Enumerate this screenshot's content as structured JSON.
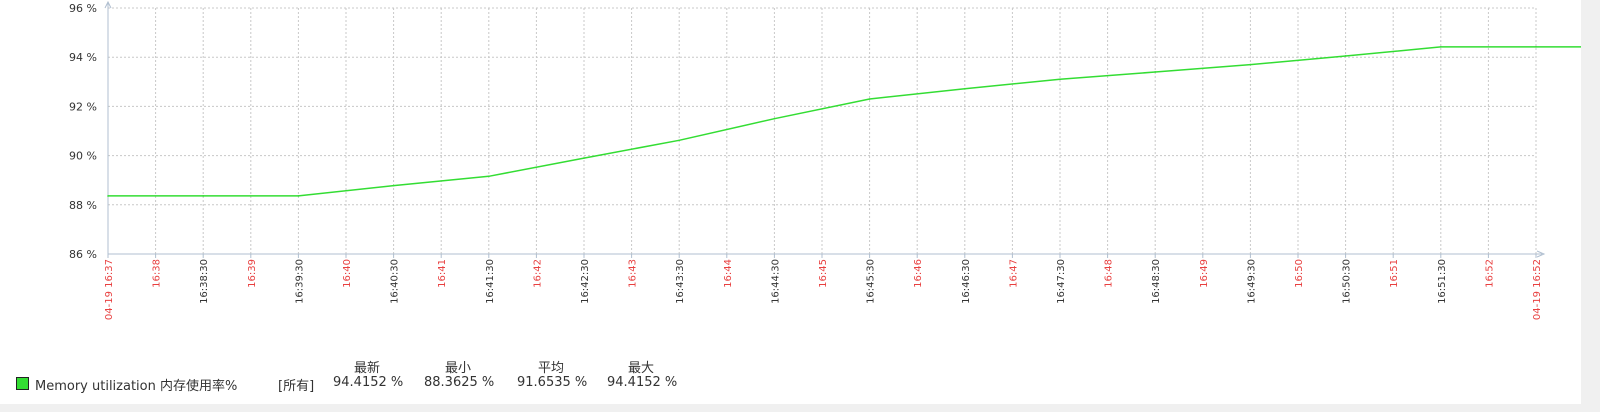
{
  "chart_data": {
    "type": "line",
    "y_ticks": [
      "86 %",
      "88 %",
      "90 %",
      "92 %",
      "94 %",
      "96 %"
    ],
    "ylim": [
      86,
      96
    ],
    "x_tick_labels": [
      {
        "label": "04-19 16:37",
        "major": true
      },
      {
        "label": "16:38",
        "major": true
      },
      {
        "label": "16:38:30",
        "major": false
      },
      {
        "label": "16:39",
        "major": true
      },
      {
        "label": "16:39:30",
        "major": false
      },
      {
        "label": "16:40",
        "major": true
      },
      {
        "label": "16:40:30",
        "major": false
      },
      {
        "label": "16:41",
        "major": true
      },
      {
        "label": "16:41:30",
        "major": false
      },
      {
        "label": "16:42",
        "major": true
      },
      {
        "label": "16:42:30",
        "major": false
      },
      {
        "label": "16:43",
        "major": true
      },
      {
        "label": "16:43:30",
        "major": false
      },
      {
        "label": "16:44",
        "major": true
      },
      {
        "label": "16:44:30",
        "major": false
      },
      {
        "label": "16:45",
        "major": true
      },
      {
        "label": "16:45:30",
        "major": false
      },
      {
        "label": "16:46",
        "major": true
      },
      {
        "label": "16:46:30",
        "major": false
      },
      {
        "label": "16:47",
        "major": true
      },
      {
        "label": "16:47:30",
        "major": false
      },
      {
        "label": "16:48",
        "major": true
      },
      {
        "label": "16:48:30",
        "major": false
      },
      {
        "label": "16:49",
        "major": true
      },
      {
        "label": "16:49:30",
        "major": false
      },
      {
        "label": "16:50",
        "major": true
      },
      {
        "label": "16:50:30",
        "major": false
      },
      {
        "label": "16:51",
        "major": true
      },
      {
        "label": "16:51:30",
        "major": false
      },
      {
        "label": "16:52",
        "major": true
      },
      {
        "label": "04-19 16:52",
        "major": true
      }
    ],
    "series": [
      {
        "name": "Memory utilization 内存使用率%",
        "color": "#33dd33",
        "x": [
          "16:37",
          "16:38",
          "16:39",
          "16:40",
          "16:41",
          "16:42",
          "16:43",
          "16:44",
          "16:45",
          "16:46",
          "16:47",
          "16:48",
          "16:49",
          "16:50",
          "16:51",
          "16:52",
          "16:52:30"
        ],
        "y": [
          88.36,
          88.36,
          88.36,
          88.78,
          89.16,
          89.9,
          90.62,
          91.5,
          92.3,
          92.72,
          93.1,
          93.4,
          93.7,
          94.05,
          94.42,
          94.42,
          94.42
        ]
      }
    ],
    "grid": true,
    "axis_color": "#b0bfd0",
    "label_colors": {
      "major": "#e84040",
      "minor": "#333333"
    },
    "legend": {
      "placement": "bottom-left",
      "group": "[所有]",
      "headers": [
        "最新",
        "最小",
        "平均",
        "最大"
      ],
      "stats": [
        "94.4152 %",
        "88.3625 %",
        "91.6535 %",
        "94.4152 %"
      ]
    }
  }
}
